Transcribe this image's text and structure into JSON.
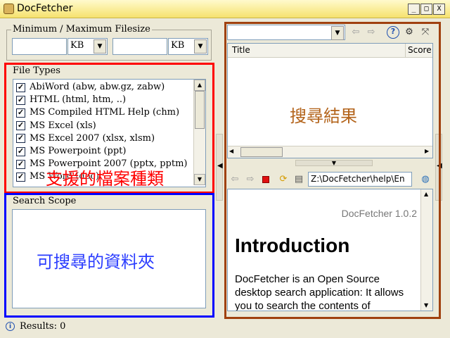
{
  "window": {
    "title": "DocFetcher",
    "minimize": "_",
    "maximize": "□",
    "close": "X"
  },
  "filesize": {
    "legend": "Minimum / Maximum Filesize",
    "min_value": "",
    "min_unit": "KB",
    "max_value": "",
    "max_unit": "KB"
  },
  "filetypes": {
    "legend": "File Types",
    "items": [
      {
        "label": "AbiWord (abw, abw.gz, zabw)",
        "checked": true
      },
      {
        "label": "HTML (html, htm, ..)",
        "checked": true
      },
      {
        "label": "MS Compiled HTML Help (chm)",
        "checked": true
      },
      {
        "label": "MS Excel (xls)",
        "checked": true
      },
      {
        "label": "MS Excel 2007 (xlsx, xlsm)",
        "checked": true
      },
      {
        "label": "MS Powerpoint (ppt)",
        "checked": true
      },
      {
        "label": "MS Powerpoint 2007 (pptx, pptm)",
        "checked": true
      },
      {
        "label": "MS Word (doc)",
        "checked": true
      }
    ],
    "annotation": "支援的檔案種類"
  },
  "scope": {
    "legend": "Search Scope",
    "annotation": "可搜尋的資料夾"
  },
  "results": {
    "query": "",
    "columns": [
      "Title",
      "Score"
    ],
    "annotation": "搜尋結果"
  },
  "preview": {
    "path": "Z:\\DocFetcher\\help\\En",
    "version": "DocFetcher 1.0.2",
    "heading": "Introduction",
    "body": "DocFetcher is an Open Source desktop search application: It allows you to search the contents of"
  },
  "status": {
    "text": "Results: 0"
  },
  "colors": {
    "red_box": "#ff0000",
    "blue_box": "#0000ff",
    "brown_box": "#a0410f",
    "annot_brown": "#b3631a",
    "annot_blue": "#2a3cff"
  }
}
